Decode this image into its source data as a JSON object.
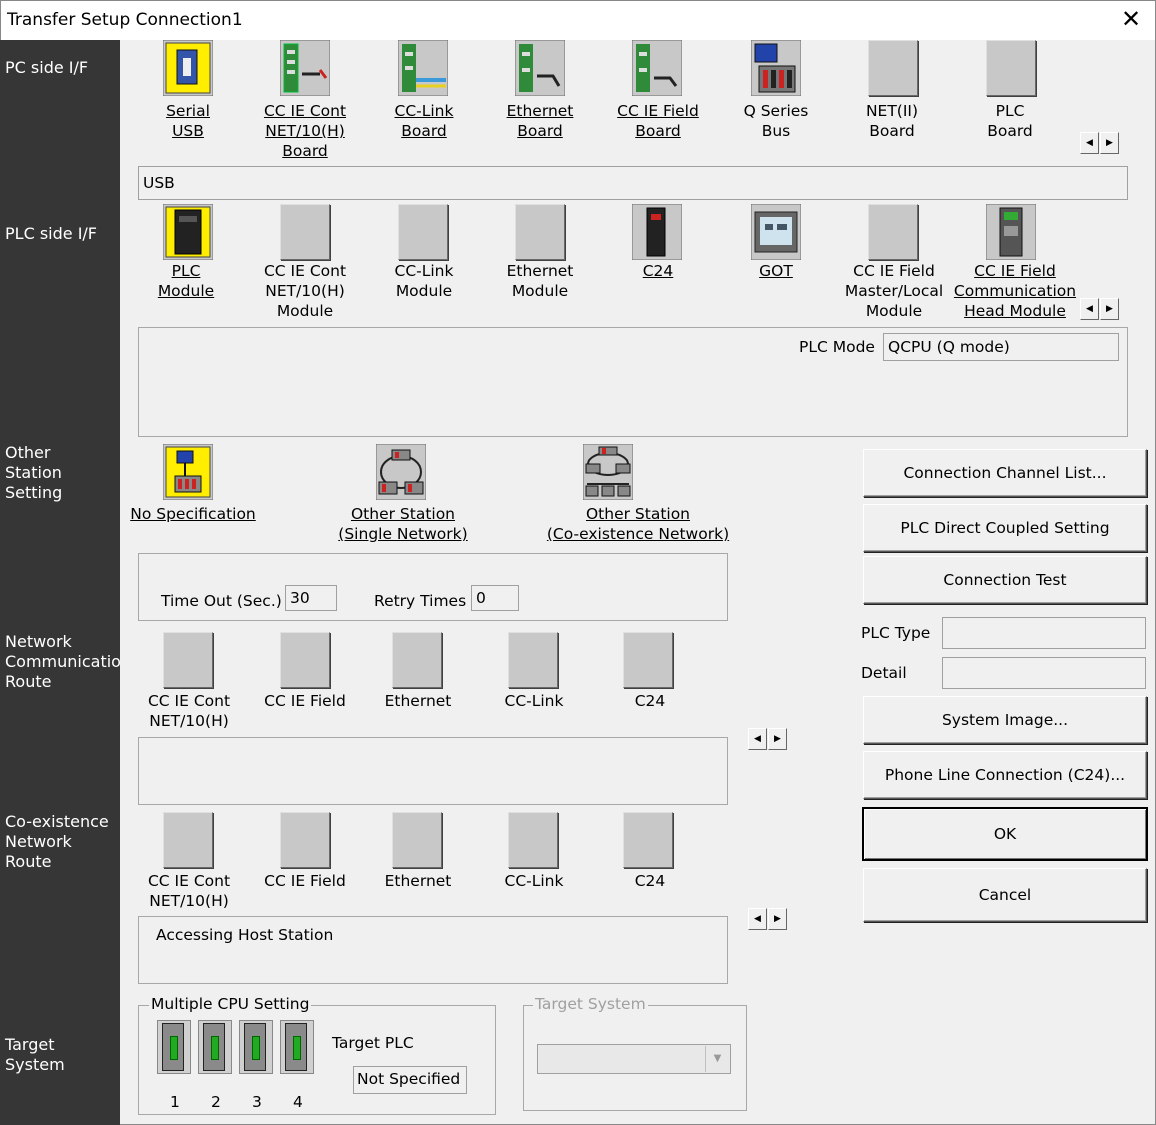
{
  "window": {
    "title": "Transfer Setup Connection1",
    "close_glyph": "✕"
  },
  "sidebar": {
    "pc_side": "PC side I/F",
    "plc_side": "PLC side I/F",
    "other_station": "Other\nStation\nSetting",
    "network_route": "Network\nCommunication\nRoute",
    "coexist_route": "Co-existence\nNetwork\nRoute",
    "target_system": "Target\nSystem"
  },
  "pc_side": {
    "items": [
      {
        "label": "Serial\nUSB",
        "icon": "serial-usb-icon"
      },
      {
        "label": "CC IE Cont\nNET/10(H)\nBoard",
        "icon": "cc-ie-cont-board-icon"
      },
      {
        "label": "CC-Link\nBoard",
        "icon": "cc-link-board-icon"
      },
      {
        "label": "Ethernet\nBoard",
        "icon": "ethernet-board-icon"
      },
      {
        "label": "CC IE Field\nBoard",
        "icon": "cc-ie-field-board-icon"
      },
      {
        "label": "Q Series\nBus",
        "icon": "q-series-bus-icon"
      },
      {
        "label": "NET(II)\nBoard",
        "icon": "net-ii-board-icon"
      },
      {
        "label": "PLC\nBoard",
        "icon": "plc-board-icon"
      }
    ],
    "selected_text": "USB"
  },
  "plc_side": {
    "items": [
      {
        "label": "PLC\nModule",
        "icon": "plc-module-icon"
      },
      {
        "label": "CC IE Cont\nNET/10(H)\nModule",
        "icon": "cc-ie-cont-module-icon"
      },
      {
        "label": "CC-Link\nModule",
        "icon": "cc-link-module-icon"
      },
      {
        "label": "Ethernet\nModule",
        "icon": "ethernet-module-icon"
      },
      {
        "label": "C24",
        "icon": "c24-icon"
      },
      {
        "label": "GOT",
        "icon": "got-icon"
      },
      {
        "label": "CC IE Field\nMaster/Local\nModule",
        "icon": "cc-ie-field-master-icon"
      },
      {
        "label": "CC IE Field\nCommunication\nHead Module",
        "icon": "cc-ie-field-head-icon"
      }
    ],
    "plc_mode_label": "PLC Mode",
    "plc_mode_value": "QCPU (Q mode)"
  },
  "other_station": {
    "items": [
      {
        "label": "No Specification"
      },
      {
        "label": "Other Station\n(Single Network)"
      },
      {
        "label": "Other Station\n(Co-existence Network)"
      }
    ],
    "timeout_label": "Time Out (Sec.)",
    "timeout_value": "30",
    "retry_label": "Retry Times",
    "retry_value": "0"
  },
  "network_route": {
    "items": [
      {
        "label": "CC IE Cont\nNET/10(H)"
      },
      {
        "label": "CC IE Field"
      },
      {
        "label": "Ethernet"
      },
      {
        "label": "CC-Link"
      },
      {
        "label": "C24"
      }
    ]
  },
  "coexist_route": {
    "items": [
      {
        "label": "CC IE Cont\nNET/10(H)"
      },
      {
        "label": "CC IE Field"
      },
      {
        "label": "Ethernet"
      },
      {
        "label": "CC-Link"
      },
      {
        "label": "C24"
      }
    ],
    "status": "Accessing Host Station"
  },
  "target": {
    "multi_cpu_legend": "Multiple CPU Setting",
    "cpu_numbers": [
      "1",
      "2",
      "3",
      "4"
    ],
    "target_plc_label": "Target PLC",
    "target_plc_value": "Not Specified",
    "target_system_legend": "Target System"
  },
  "buttons": {
    "channel_list": "Connection Channel List...",
    "direct_coupled": "PLC Direct Coupled Setting",
    "connection_test": "Connection Test",
    "plc_type_label": "PLC Type",
    "detail_label": "Detail",
    "system_image": "System Image...",
    "phone_line": "Phone Line Connection (C24)...",
    "ok": "OK",
    "cancel": "Cancel"
  },
  "colors": {
    "sidebar": "#363636",
    "dialog": "#f0f0f0",
    "accent_yellow": "#ffee00"
  }
}
